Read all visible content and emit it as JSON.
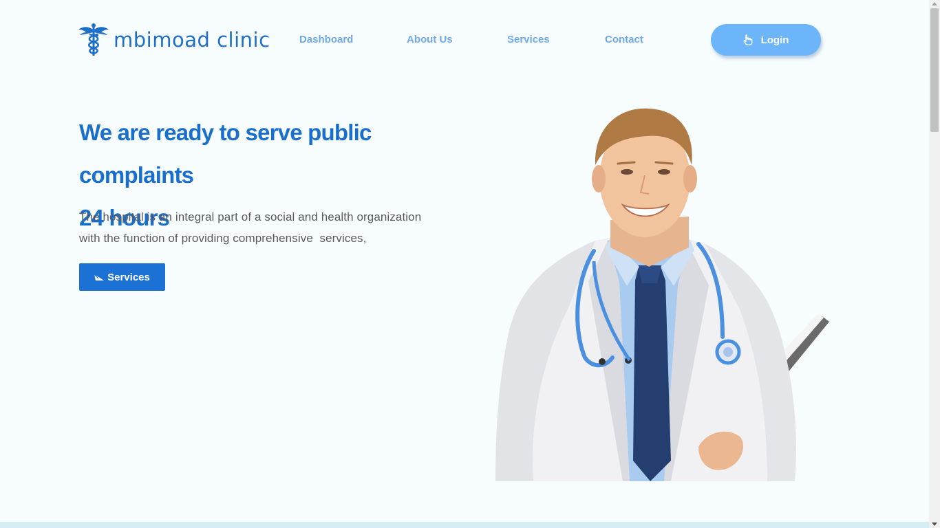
{
  "brand": {
    "name": "mbimoad clinic",
    "logo_icon": "caduceus-icon",
    "color": "#1f6fc7"
  },
  "nav": {
    "items": [
      {
        "label": "Dashboard"
      },
      {
        "label": "About Us"
      },
      {
        "label": "Services"
      },
      {
        "label": "Contact"
      }
    ],
    "login_label": "Login",
    "login_icon": "pointer-hand-icon"
  },
  "hero": {
    "title_line1": "We are ready to serve public complaints",
    "title_line2": "24 hours",
    "description_line1": "The hospital is an integral part of a social and health organization",
    "description_line2": "with the function of providing comprehensive  services,",
    "button_label": "Services",
    "button_icon": "paper-plane-icon",
    "image": "doctor-photo"
  },
  "colors": {
    "accent": "#1b72d4",
    "nav_link": "#6fa9e6",
    "login_bg": "#6cb5fa",
    "background": "#f7fdfe"
  }
}
